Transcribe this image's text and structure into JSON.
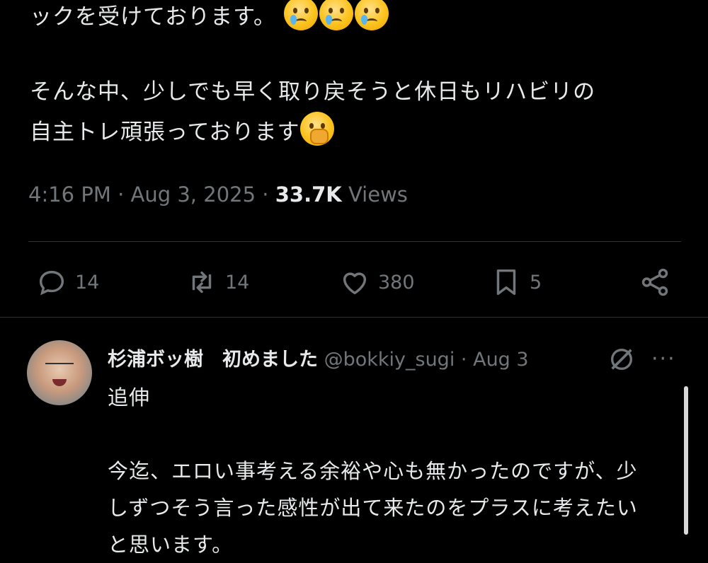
{
  "tweet": {
    "line1": "ックを受けております。",
    "line2": "",
    "line3": "そんな中、少しでも早く取り戻そうと休日もリハビリの",
    "line4": "自主トレ頑張っております",
    "emoji_line1": [
      "crying-face",
      "crying-face",
      "crying-face"
    ],
    "emoji_line4": "face-with-hand-over-mouth",
    "time": "4:16 PM",
    "date": "Aug 3, 2025",
    "views_count": "33.7K",
    "views_label": "Views"
  },
  "actions": {
    "replies": "14",
    "reposts": "14",
    "likes": "380",
    "bookmarks": "5"
  },
  "reply": {
    "name": "杉浦ボッ樹　初めました",
    "handle": "@bokkiy_sugi",
    "date": "Aug 3",
    "line1": "追伸",
    "line2": "",
    "line3": "今迄、エロい事考える余裕や心も無かったのですが、少",
    "line4": "しずつそう言った感性が出て来たのをプラスに考えたい",
    "line5": "と思います。"
  },
  "colors": {
    "background": "#000000",
    "text": "#e7e9ea",
    "muted": "#71767b",
    "divider": "#2f3336"
  }
}
